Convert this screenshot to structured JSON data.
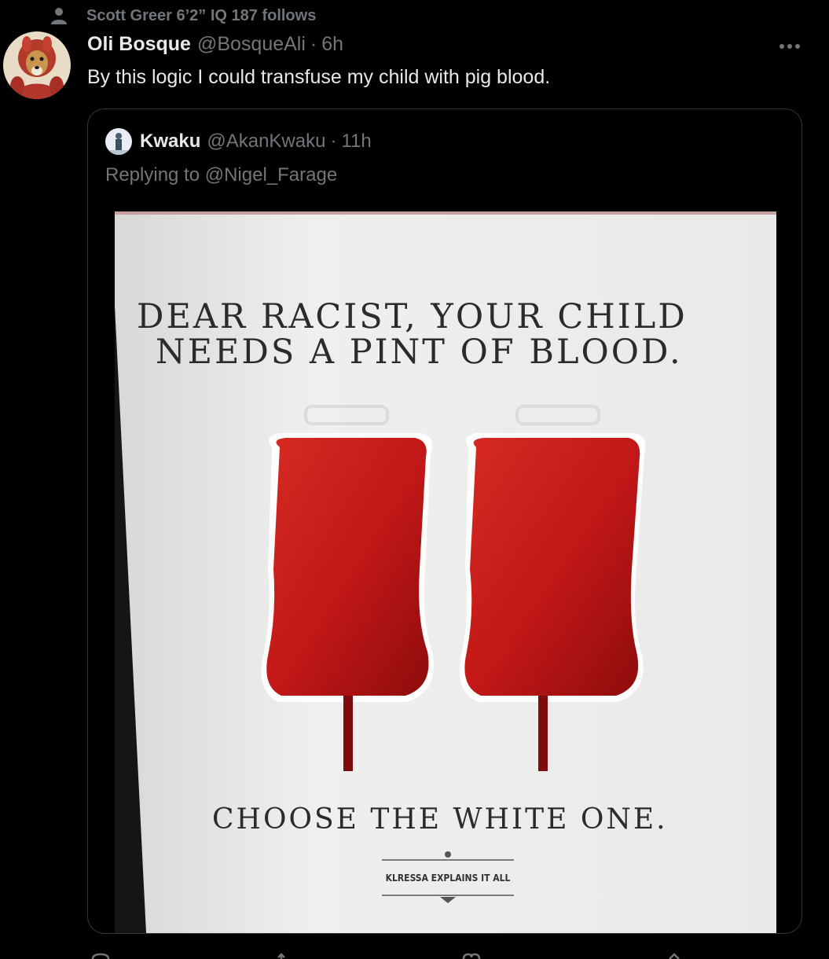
{
  "social_context": {
    "text": "Scott Greer 6’2” IQ 187 follows",
    "icon": "person-icon"
  },
  "tweet": {
    "display_name": "Oli Bosque",
    "handle": "@BosqueAli",
    "separator": "·",
    "time": "6h",
    "text": "By this logic I could transfuse my child with pig blood.",
    "more_icon": "more-horizontal-icon"
  },
  "quote": {
    "display_name": "Kwaku",
    "handle": "@AkanKwaku",
    "separator": "·",
    "time": "11h",
    "replying_to": "Replying to @Nigel_Farage",
    "image": {
      "headline_line1": "DEAR RACIST, YOUR CHILD",
      "headline_line2": "NEEDS A PINT OF BLOOD.",
      "tagline": "CHOOSE THE WHITE ONE.",
      "signature": "KLRESSA EXPLAINS IT ALL"
    }
  },
  "actions": [
    "reply-icon",
    "retweet-icon",
    "like-icon",
    "share-icon"
  ],
  "colors": {
    "background": "#000000",
    "primary_text": "#e7e9ea",
    "secondary_text": "#71767b",
    "border": "#333639",
    "blood_red": "#c41818"
  }
}
